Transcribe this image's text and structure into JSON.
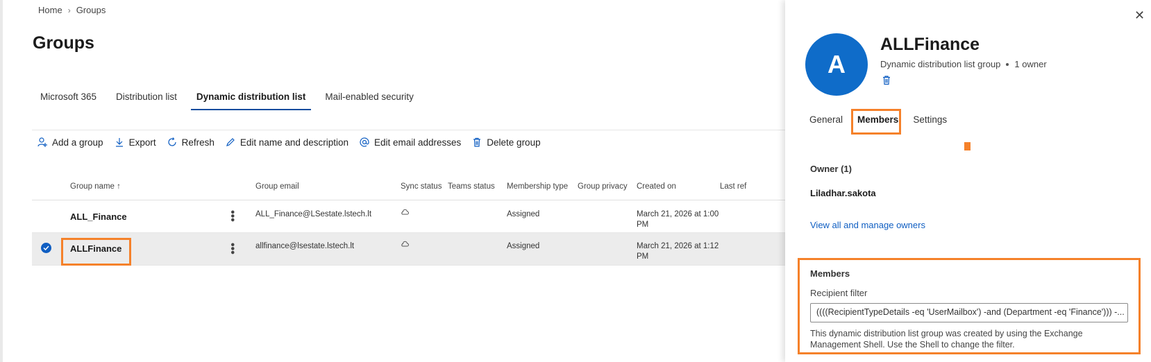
{
  "breadcrumb": {
    "home": "Home",
    "current": "Groups"
  },
  "page": {
    "title": "Groups"
  },
  "tabs": [
    {
      "label": "Microsoft 365"
    },
    {
      "label": "Distribution list"
    },
    {
      "label": "Dynamic distribution list",
      "active": true
    },
    {
      "label": "Mail-enabled security"
    }
  ],
  "toolbar": {
    "add_group": "Add a group",
    "export": "Export",
    "refresh": "Refresh",
    "edit_name": "Edit name and description",
    "edit_email": "Edit email addresses",
    "delete_group": "Delete group"
  },
  "table": {
    "headers": {
      "group_name": "Group name",
      "group_email": "Group email",
      "sync_status": "Sync status",
      "teams_status": "Teams status",
      "membership_type": "Membership type",
      "group_privacy": "Group privacy",
      "created_on": "Created on",
      "last_refreshed": "Last ref"
    },
    "rows": [
      {
        "name": "ALL_Finance",
        "email": "ALL_Finance@LSestate.lstech.lt",
        "membership": "Assigned",
        "created_line1": "March 21, 2026 at 1:00",
        "created_line2": "PM",
        "selected": false
      },
      {
        "name": "ALLFinance",
        "email": "allfinance@lsestate.lstech.lt",
        "membership": "Assigned",
        "created_line1": "March 21, 2026 at 1:12",
        "created_line2": "PM",
        "selected": true
      }
    ]
  },
  "panel": {
    "avatar_letter": "A",
    "title": "ALLFinance",
    "subtitle": "Dynamic distribution list group",
    "owners": "1 owner",
    "tabs": [
      {
        "label": "General"
      },
      {
        "label": "Members",
        "active": true
      },
      {
        "label": "Settings"
      }
    ],
    "owner_section": "Owner (1)",
    "owner_name": "Liladhar.sakota",
    "view_owners_link": "View all and manage owners",
    "members_section": "Members",
    "recipient_filter_label": "Recipient filter",
    "recipient_filter_value": "((((RecipientTypeDetails -eq 'UserMailbox') -and (Department -eq 'Finance'))) -...",
    "note": "This dynamic distribution list group was created by using the Exchange Management Shell. Use the Shell to change the filter."
  },
  "colors": {
    "accent": "#0f6cc9",
    "highlight": "#f5812a",
    "tab_underline": "#0f4c9e"
  }
}
